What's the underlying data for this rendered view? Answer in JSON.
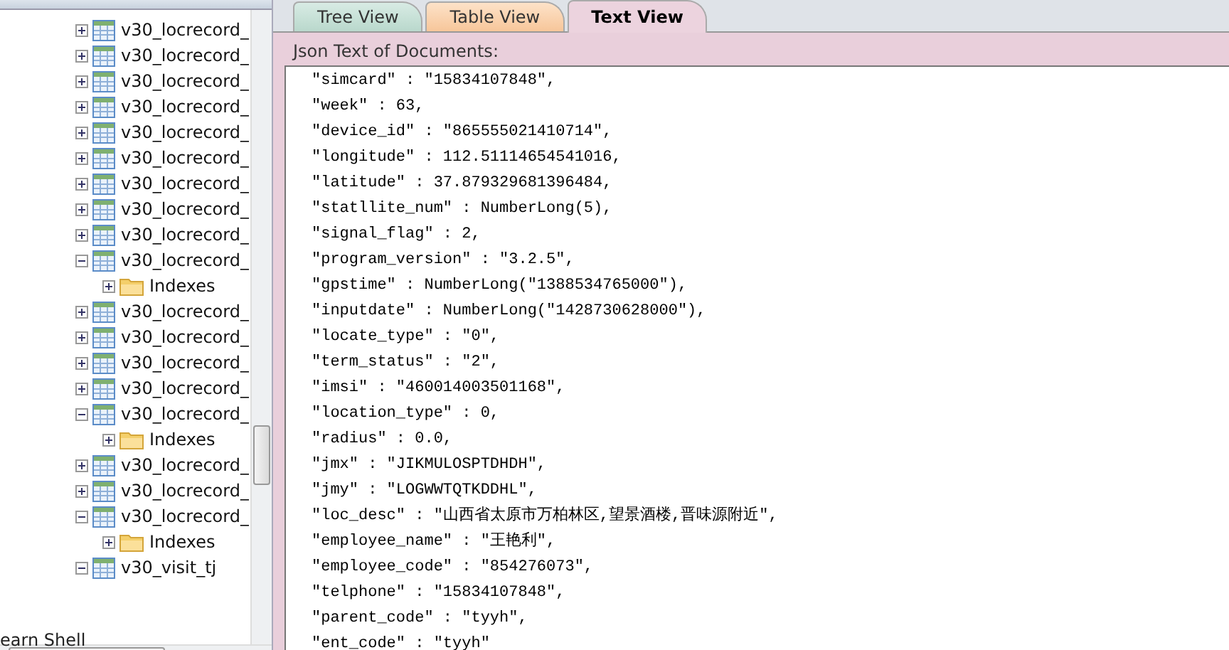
{
  "tree": {
    "items": [
      {
        "label": "v30_locrecord_",
        "expanded": false
      },
      {
        "label": "v30_locrecord_",
        "expanded": false
      },
      {
        "label": "v30_locrecord_",
        "expanded": false
      },
      {
        "label": "v30_locrecord_",
        "expanded": false
      },
      {
        "label": "v30_locrecord_",
        "expanded": false
      },
      {
        "label": "v30_locrecord_",
        "expanded": false
      },
      {
        "label": "v30_locrecord_",
        "expanded": false
      },
      {
        "label": "v30_locrecord_",
        "expanded": false
      },
      {
        "label": "v30_locrecord_",
        "expanded": false
      },
      {
        "label": "v30_locrecord_",
        "expanded": true,
        "children": [
          {
            "label": "Indexes",
            "expanded": false
          }
        ]
      },
      {
        "label": "v30_locrecord_",
        "expanded": false
      },
      {
        "label": "v30_locrecord_",
        "expanded": false
      },
      {
        "label": "v30_locrecord_",
        "expanded": false
      },
      {
        "label": "v30_locrecord_",
        "expanded": false
      },
      {
        "label": "v30_locrecord_",
        "expanded": true,
        "children": [
          {
            "label": "Indexes",
            "expanded": false
          }
        ]
      },
      {
        "label": "v30_locrecord_",
        "expanded": false
      },
      {
        "label": "v30_locrecord_",
        "expanded": false
      },
      {
        "label": "v30_locrecord_",
        "expanded": true,
        "children": [
          {
            "label": "Indexes",
            "expanded": false
          }
        ]
      },
      {
        "label": "v30_visit_tj",
        "expanded": true
      }
    ]
  },
  "tabs": [
    {
      "label": "Tree View",
      "selected": false
    },
    {
      "label": "Table View",
      "selected": false
    },
    {
      "label": "Text View",
      "selected": true
    }
  ],
  "json_text": {
    "label": "Json Text of Documents:",
    "lines": [
      "\"simcard\" : \"15834107848\",",
      "\"week\" : 63,",
      "\"device_id\" : \"865555021410714\",",
      "\"longitude\" : 112.51114654541016,",
      "\"latitude\" : 37.879329681396484,",
      "\"statllite_num\" : NumberLong(5),",
      "\"signal_flag\" : 2,",
      "\"program_version\" : \"3.2.5\",",
      "\"gpstime\" : NumberLong(\"1388534765000\"),",
      "\"inputdate\" : NumberLong(\"1428730628000\"),",
      "\"locate_type\" : \"0\",",
      "\"term_status\" : \"2\",",
      "\"imsi\" : \"460014003501168\",",
      "\"location_type\" : 0,",
      "\"radius\" : 0.0,",
      "\"jmx\" : \"JIKMULOSPTDHDH\",",
      "\"jmy\" : \"LOGWWTQTKDDHL\",",
      "\"loc_desc\" : \"山西省太原市万柏林区,望景酒楼,晋味源附近\",",
      "\"employee_name\" : \"王艳利\",",
      "\"employee_code\" : \"854276073\",",
      "\"telphone\" : \"15834107848\",",
      "\"parent_code\" : \"tyyh\",",
      "\"ent_code\" : \"tyyh\""
    ]
  },
  "status_bar": {
    "text": "earn Shell"
  }
}
